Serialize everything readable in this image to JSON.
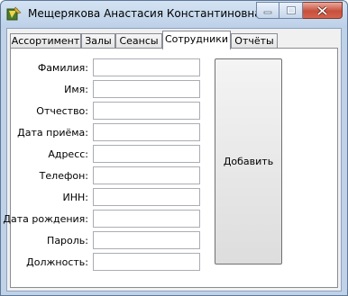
{
  "window": {
    "title": "Мещерякова Анастасия Константиновна"
  },
  "tabs": [
    {
      "label": "Ассортимент"
    },
    {
      "label": "Залы"
    },
    {
      "label": "Сеансы"
    },
    {
      "label": "Сотрудники"
    },
    {
      "label": "Отчёты"
    }
  ],
  "active_tab": "Сотрудники",
  "form": {
    "fields": [
      {
        "label": "Фамилия:",
        "value": ""
      },
      {
        "label": "Имя:",
        "value": ""
      },
      {
        "label": "Отчество:",
        "value": ""
      },
      {
        "label": "Дата приёма:",
        "value": ""
      },
      {
        "label": "Адресс:",
        "value": ""
      },
      {
        "label": "Телефон:",
        "value": ""
      },
      {
        "label": "ИНН:",
        "value": ""
      },
      {
        "label": "Дата рождения:",
        "value": ""
      },
      {
        "label": "Пароль:",
        "value": ""
      },
      {
        "label": "Должность:",
        "value": ""
      }
    ],
    "add_label": "Добавить"
  }
}
